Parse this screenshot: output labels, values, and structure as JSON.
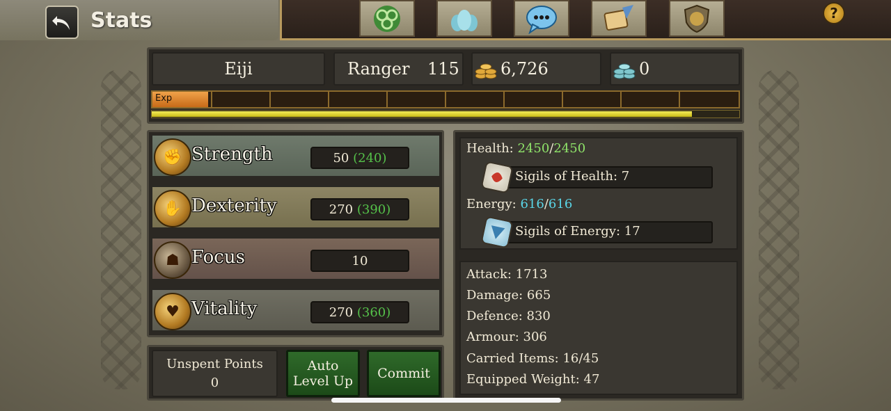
{
  "header": {
    "title": "Stats",
    "back_icon": "back-arrow-icon",
    "nav_buttons": [
      {
        "name": "triskele-icon"
      },
      {
        "name": "party-icon"
      },
      {
        "name": "chat-icon"
      },
      {
        "name": "quest-scroll-icon"
      },
      {
        "name": "guild-crest-icon"
      }
    ],
    "help_label": "?"
  },
  "character": {
    "name": "Eiji",
    "class": "Ranger",
    "level": "115",
    "gold": "6,726",
    "platinum": "0",
    "exp_label": "Exp",
    "exp_progress": 0.095,
    "level_progress": 0.92
  },
  "stats": [
    {
      "name": "Strength",
      "base": "50",
      "total": "(240)",
      "icon": "strength-fist-icon"
    },
    {
      "name": "Dexterity",
      "base": "270",
      "total": "(390)",
      "icon": "dexterity-gauntlet-icon"
    },
    {
      "name": "Focus",
      "base": "10",
      "total": "",
      "icon": "focus-mask-icon"
    },
    {
      "name": "Vitality",
      "base": "270",
      "total": "(360)",
      "icon": "vitality-heart-icon"
    }
  ],
  "points": {
    "unspent_label": "Unspent Points",
    "unspent_value": "0",
    "auto_level_line1": "Auto",
    "auto_level_line2": "Level Up",
    "commit_label": "Commit"
  },
  "vitals": {
    "health_label": "Health:",
    "health_current": "2450",
    "health_sep": "/",
    "health_max": "2450",
    "sigils_health": "Sigils of Health: 7",
    "energy_label": "Energy:",
    "energy_current": "616",
    "energy_sep": "/",
    "energy_max": "616",
    "sigils_energy": "Sigils of Energy: 17"
  },
  "combat": {
    "attack": "Attack: 1713",
    "damage": "Damage: 665",
    "defence": "Defence: 830",
    "armour": "Armour: 306",
    "carried": "Carried Items: 16/45",
    "weight": "Equipped Weight: 47"
  },
  "colors": {
    "bonus_green": "#55c24a",
    "health_green": "#8fe46a",
    "energy_cyan": "#5ad6e8",
    "button_green": "#2f6a2a"
  }
}
